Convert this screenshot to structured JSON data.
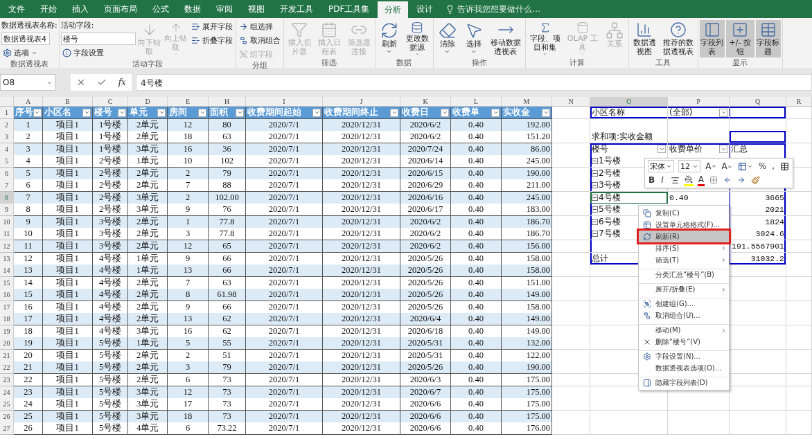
{
  "tabs": [
    {
      "label": "文件",
      "selected": false
    },
    {
      "label": "开始",
      "selected": false
    },
    {
      "label": "插入",
      "selected": false
    },
    {
      "label": "页面布局",
      "selected": false
    },
    {
      "label": "公式",
      "selected": false
    },
    {
      "label": "数据",
      "selected": false
    },
    {
      "label": "审阅",
      "selected": false
    },
    {
      "label": "视图",
      "selected": false
    },
    {
      "label": "开发工具",
      "selected": false
    },
    {
      "label": "PDF工具集",
      "selected": false
    },
    {
      "label": "分析",
      "selected": true
    },
    {
      "label": "设计",
      "selected": false
    }
  ],
  "tell_me": {
    "placeholder": "告诉我您想要做什么..."
  },
  "ribbon": {
    "groups": [
      {
        "label": "数据透视表",
        "items": [
          {
            "kind": "stack",
            "items": [
              {
                "kind": "label",
                "label": "数据透视表名称:"
              },
              {
                "kind": "field",
                "value": "数据透视表4"
              },
              {
                "kind": "small",
                "label": "选项",
                "caret": true,
                "disabled": false
              }
            ]
          }
        ]
      },
      {
        "label": "活动字段",
        "items": [
          {
            "kind": "stack",
            "items": [
              {
                "kind": "label",
                "label": "活动字段:"
              },
              {
                "kind": "field",
                "value": "楼号"
              },
              {
                "kind": "small",
                "label": "字段设置",
                "caret": false,
                "disabled": false
              }
            ]
          },
          {
            "kind": "large",
            "label": "向下钻取",
            "caret": false,
            "disabled": true,
            "selected": false
          },
          {
            "kind": "large",
            "label": "向上钻取",
            "caret": true,
            "disabled": true,
            "selected": false
          },
          {
            "kind": "stack",
            "items": [
              {
                "kind": "small",
                "label": "展开字段",
                "caret": false,
                "disabled": false
              },
              {
                "kind": "small",
                "label": "折叠字段",
                "caret": false,
                "disabled": false
              }
            ]
          }
        ]
      },
      {
        "label": "分组",
        "items": [
          {
            "kind": "stack",
            "items": [
              {
                "kind": "small",
                "label": "组选择",
                "caret": false,
                "disabled": false
              },
              {
                "kind": "small",
                "label": "取消组合",
                "caret": false,
                "disabled": false
              },
              {
                "kind": "small",
                "label": "组字段",
                "caret": false,
                "disabled": true
              }
            ]
          }
        ]
      },
      {
        "label": "筛选",
        "items": [
          {
            "kind": "large",
            "label": "插入切片器",
            "caret": false,
            "disabled": true,
            "selected": false
          },
          {
            "kind": "large",
            "label": "插入日程表",
            "caret": false,
            "disabled": true,
            "selected": false
          },
          {
            "kind": "large",
            "label": "筛选器连接",
            "caret": false,
            "disabled": true,
            "selected": false
          }
        ]
      },
      {
        "label": "数据",
        "items": [
          {
            "kind": "large",
            "label": "刷新",
            "caret": true,
            "disabled": false,
            "selected": false
          },
          {
            "kind": "large",
            "label": "更改数据源",
            "caret": true,
            "disabled": false,
            "selected": false
          }
        ]
      },
      {
        "label": "操作",
        "items": [
          {
            "kind": "large",
            "label": "清除",
            "caret": true,
            "disabled": false,
            "selected": false
          },
          {
            "kind": "large",
            "label": "选择",
            "caret": true,
            "disabled": false,
            "selected": false
          },
          {
            "kind": "large",
            "label": "移动数据透视表",
            "caret": false,
            "disabled": false,
            "selected": false
          }
        ]
      },
      {
        "label": "计算",
        "items": [
          {
            "kind": "large",
            "label": "字段、项目和集",
            "caret": true,
            "disabled": false,
            "selected": false
          },
          {
            "kind": "large",
            "label": "OLAP 工具",
            "caret": true,
            "disabled": true,
            "selected": false
          },
          {
            "kind": "large",
            "label": "关系",
            "caret": false,
            "disabled": true,
            "selected": false
          }
        ]
      },
      {
        "label": "工具",
        "items": [
          {
            "kind": "large",
            "label": "数据透视图",
            "caret": false,
            "disabled": false,
            "selected": false
          },
          {
            "kind": "large",
            "label": "推荐的数据透视表",
            "caret": false,
            "disabled": false,
            "selected": false
          }
        ]
      },
      {
        "label": "显示",
        "items": [
          {
            "kind": "large",
            "label": "字段列表",
            "caret": false,
            "disabled": false,
            "selected": true
          },
          {
            "kind": "large",
            "label": "+/- 按钮",
            "caret": false,
            "disabled": false,
            "selected": true
          },
          {
            "kind": "large",
            "label": "字段标题",
            "caret": false,
            "disabled": false,
            "selected": true
          }
        ]
      }
    ]
  },
  "formula_bar": {
    "name_box": "O8",
    "function_label": "fx",
    "value": "4号楼"
  },
  "row_numbers": [
    "1",
    "2",
    "3",
    "4",
    "5",
    "6",
    "7",
    "8",
    "9",
    "10",
    "11",
    "12",
    "13",
    "14",
    "15",
    "16",
    "17",
    "18",
    "19",
    "20",
    "21",
    "22",
    "23",
    "24",
    "25",
    "26",
    "27"
  ],
  "columns": [
    "A",
    "B",
    "C",
    "D",
    "E",
    "H",
    "I",
    "J",
    "K",
    "L",
    "M",
    "N",
    "O",
    "P",
    "Q",
    "R"
  ],
  "table": {
    "headers": [
      "序号",
      "小区名",
      "楼号",
      "单元",
      "房间",
      "面积",
      "收费期间起始",
      "收费期间终止",
      "收费日",
      "收费单",
      "实收金"
    ],
    "rows": [
      [
        "1",
        "项目1",
        "1号楼",
        "2单元",
        "12",
        "80",
        "2020/7/1",
        "2020/12/31",
        "2020/6/2",
        "0.40",
        "192.00"
      ],
      [
        "2",
        "项目1",
        "1号楼",
        "2单元",
        "18",
        "63",
        "2020/7/1",
        "2020/12/31",
        "2020/6/2",
        "0.40",
        "151.20"
      ],
      [
        "3",
        "项目1",
        "1号楼",
        "3单元",
        "16",
        "36",
        "2020/7/1",
        "2020/12/31",
        "2020/7/24",
        "0.40",
        "86.00"
      ],
      [
        "4",
        "项目1",
        "2号楼",
        "1单元",
        "10",
        "102",
        "2020/7/1",
        "2020/12/31",
        "2020/6/14",
        "0.40",
        "245.00"
      ],
      [
        "5",
        "项目1",
        "2号楼",
        "2单元",
        "2",
        "79",
        "2020/7/1",
        "2020/12/31",
        "2020/6/15",
        "0.40",
        "190.00"
      ],
      [
        "6",
        "项目1",
        "2号楼",
        "2单元",
        "7",
        "88",
        "2020/7/1",
        "2020/12/31",
        "2020/6/29",
        "0.40",
        "211.00"
      ],
      [
        "7",
        "项目1",
        "2号楼",
        "3单元",
        "2",
        "102.00",
        "2020/7/1",
        "2020/12/31",
        "2020/6/16",
        "0.40",
        "245.00"
      ],
      [
        "8",
        "项目1",
        "2号楼",
        "3单元",
        "9",
        "76",
        "2020/7/1",
        "2020/12/31",
        "2020/6/17",
        "0.40",
        "183.00"
      ],
      [
        "9",
        "项目1",
        "3号楼",
        "2单元",
        "1",
        "77.8",
        "2020/7/1",
        "2020/12/31",
        "2020/6/2",
        "0.40",
        "186.70"
      ],
      [
        "10",
        "项目1",
        "3号楼",
        "2单元",
        "3",
        "77.8",
        "2020/7/1",
        "2020/12/31",
        "2020/6/2",
        "0.40",
        "186.70"
      ],
      [
        "11",
        "项目1",
        "3号楼",
        "2单元",
        "12",
        "65",
        "2020/7/1",
        "2020/12/31",
        "2020/6/2",
        "0.40",
        "156.00"
      ],
      [
        "12",
        "项目1",
        "4号楼",
        "1单元",
        "9",
        "66",
        "2020/7/1",
        "2020/12/31",
        "2020/5/26",
        "0.40",
        "158.00"
      ],
      [
        "13",
        "项目1",
        "4号楼",
        "1单元",
        "13",
        "66",
        "2020/7/1",
        "2020/12/31",
        "2020/5/26",
        "0.40",
        "158.00"
      ],
      [
        "14",
        "项目1",
        "4号楼",
        "2单元",
        "7",
        "63",
        "2020/7/1",
        "2020/12/31",
        "2020/5/26",
        "0.40",
        "151.00"
      ],
      [
        "15",
        "项目1",
        "4号楼",
        "2单元",
        "8",
        "61.98",
        "2020/7/1",
        "2020/12/31",
        "2020/5/26",
        "0.40",
        "149.00"
      ],
      [
        "16",
        "项目1",
        "4号楼",
        "2单元",
        "9",
        "66",
        "2020/7/1",
        "2020/12/31",
        "2020/5/26",
        "0.40",
        "158.00"
      ],
      [
        "17",
        "项目1",
        "4号楼",
        "2单元",
        "13",
        "62",
        "2020/7/1",
        "2020/12/31",
        "2020/6/4",
        "0.40",
        "149.00"
      ],
      [
        "18",
        "项目1",
        "4号楼",
        "3单元",
        "16",
        "62",
        "2020/7/1",
        "2020/12/31",
        "2020/6/18",
        "0.40",
        "149.00"
      ],
      [
        "19",
        "项目1",
        "5号楼",
        "1单元",
        "5",
        "55",
        "2020/7/1",
        "2020/12/31",
        "2020/5/31",
        "0.40",
        "132.00"
      ],
      [
        "20",
        "项目1",
        "5号楼",
        "2单元",
        "2",
        "51",
        "2020/7/1",
        "2020/12/31",
        "2020/5/31",
        "0.40",
        "122.00"
      ],
      [
        "21",
        "项目1",
        "5号楼",
        "2单元",
        "3",
        "79",
        "2020/7/1",
        "2020/12/31",
        "2020/5/26",
        "0.40",
        "190.00"
      ],
      [
        "22",
        "项目1",
        "5号楼",
        "2单元",
        "6",
        "73",
        "2020/7/1",
        "2020/12/31",
        "2020/6/3",
        "0.40",
        "175.00"
      ],
      [
        "23",
        "项目1",
        "5号楼",
        "3单元",
        "12",
        "73",
        "2020/7/1",
        "2020/12/31",
        "2020/6/7",
        "0.40",
        "175.00"
      ],
      [
        "24",
        "项目1",
        "5号楼",
        "3单元",
        "17",
        "73",
        "2020/7/1",
        "2020/12/31",
        "2020/6/6",
        "0.40",
        "175.00"
      ],
      [
        "25",
        "项目1",
        "5号楼",
        "3单元",
        "18",
        "73",
        "2020/7/1",
        "2020/12/31",
        "2020/6/6",
        "0.40",
        "175.00"
      ],
      [
        "26",
        "项目1",
        "5号楼",
        "4单元",
        "6",
        "73.22",
        "2020/7/1",
        "2020/12/31",
        "2020/6/6",
        "0.40",
        "176.00"
      ]
    ]
  },
  "pivot": {
    "filter": {
      "field": "小区名称",
      "value": "(全部)"
    },
    "value_label": "求和项:实收金额",
    "headers": [
      "楼号",
      "收费单价",
      "汇总"
    ],
    "items": [
      {
        "label": "1号楼",
        "expanded": true,
        "selected": false
      },
      {
        "label": "2号楼",
        "expanded": true,
        "selected": false
      },
      {
        "label": "3号楼",
        "expanded": true,
        "selected": false
      },
      {
        "label": "4号楼",
        "expanded": true,
        "selected": true,
        "price": "0.40",
        "total": "3665"
      },
      {
        "label": "5号楼",
        "expanded": true,
        "selected": false,
        "total": "2021"
      },
      {
        "label": "6号楼",
        "expanded": true,
        "selected": false,
        "total": "1824"
      },
      {
        "label": "7号楼",
        "expanded": true,
        "selected": false,
        "total": "3024.6"
      }
    ],
    "extra_row": {
      "total": "191.5567901"
    },
    "grand_total": {
      "label": "总计",
      "total": "31032.2"
    }
  },
  "mini_toolbar": {
    "font": "宋体",
    "size": "12",
    "row_1": [
      {
        "kind": "grow",
        "label": "A"
      },
      {
        "kind": "shrink",
        "label": "A"
      },
      {
        "kind": "format"
      },
      {
        "kind": "text",
        "label": "%"
      },
      {
        "kind": "text",
        "label": ","
      },
      {
        "kind": "table"
      }
    ],
    "row_2": [
      {
        "kind": "bold",
        "label": "B"
      },
      {
        "kind": "italic",
        "label": "I"
      },
      {
        "kind": "align"
      },
      {
        "kind": "fill"
      },
      {
        "kind": "fontcolor",
        "label": "A"
      },
      {
        "kind": "border"
      },
      {
        "kind": "inc"
      },
      {
        "kind": "dec"
      },
      {
        "kind": "brush"
      }
    ]
  },
  "context_menu": [
    {
      "label": "复制(C)",
      "divider": false,
      "submenu": false,
      "highlighted": false
    },
    {
      "label": "设置单元格格式(F)...",
      "divider": false,
      "submenu": false,
      "highlighted": false
    },
    {
      "label": "刷新(R)",
      "divider": false,
      "submenu": false,
      "highlighted": true
    },
    {
      "label": "排序(S)",
      "divider": false,
      "submenu": true,
      "highlighted": false
    },
    {
      "label": "筛选(T)",
      "divider": false,
      "submenu": true,
      "highlighted": false
    },
    {
      "label": "分类汇总“楼号”(B)",
      "divider": true,
      "submenu": false,
      "highlighted": false
    },
    {
      "label": "展开/折叠(E)",
      "divider": true,
      "submenu": true,
      "highlighted": false
    },
    {
      "label": "创建组(G)...",
      "divider": true,
      "submenu": false,
      "highlighted": false
    },
    {
      "label": "取消组合(U)...",
      "divider": false,
      "submenu": false,
      "highlighted": false
    },
    {
      "label": "移动(M)",
      "divider": true,
      "submenu": true,
      "highlighted": false
    },
    {
      "label": "删除“楼号”(V)",
      "divider": false,
      "submenu": false,
      "highlighted": false
    },
    {
      "label": "字段设置(N)...",
      "divider": true,
      "submenu": false,
      "highlighted": false
    },
    {
      "label": "数据透视表选项(O)...",
      "divider": false,
      "submenu": false,
      "highlighted": false
    },
    {
      "label": "隐藏字段列表(D)",
      "divider": true,
      "submenu": false,
      "highlighted": false
    }
  ]
}
